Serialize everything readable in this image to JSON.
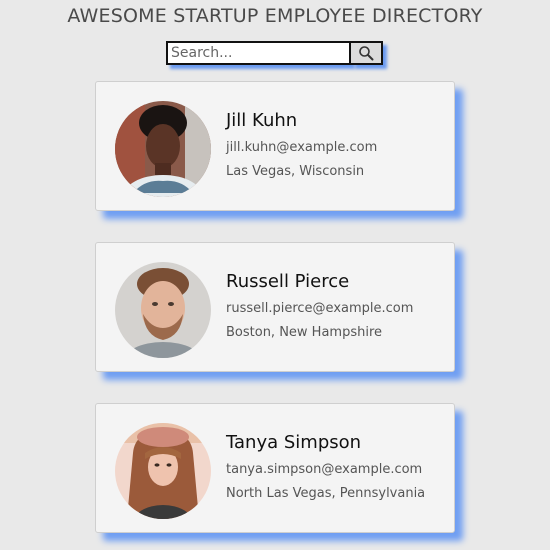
{
  "header": {
    "title": "AWESOME STARTUP EMPLOYEE DIRECTORY"
  },
  "search": {
    "placeholder": "Search...",
    "button_icon": "search-icon"
  },
  "employees": [
    {
      "name": "Jill Kuhn",
      "email": "jill.kuhn@example.com",
      "location": "Las Vegas, Wisconsin",
      "avatar_icon": "avatar-photo"
    },
    {
      "name": "Russell Pierce",
      "email": "russell.pierce@example.com",
      "location": "Boston, New Hampshire",
      "avatar_icon": "avatar-photo"
    },
    {
      "name": "Tanya Simpson",
      "email": "tanya.simpson@example.com",
      "location": "North Las Vegas, Pennsylvania",
      "avatar_icon": "avatar-photo"
    }
  ],
  "colors": {
    "background": "#e9e9e9",
    "card": "#f4f4f4",
    "shadow": "#6f9ef2"
  }
}
